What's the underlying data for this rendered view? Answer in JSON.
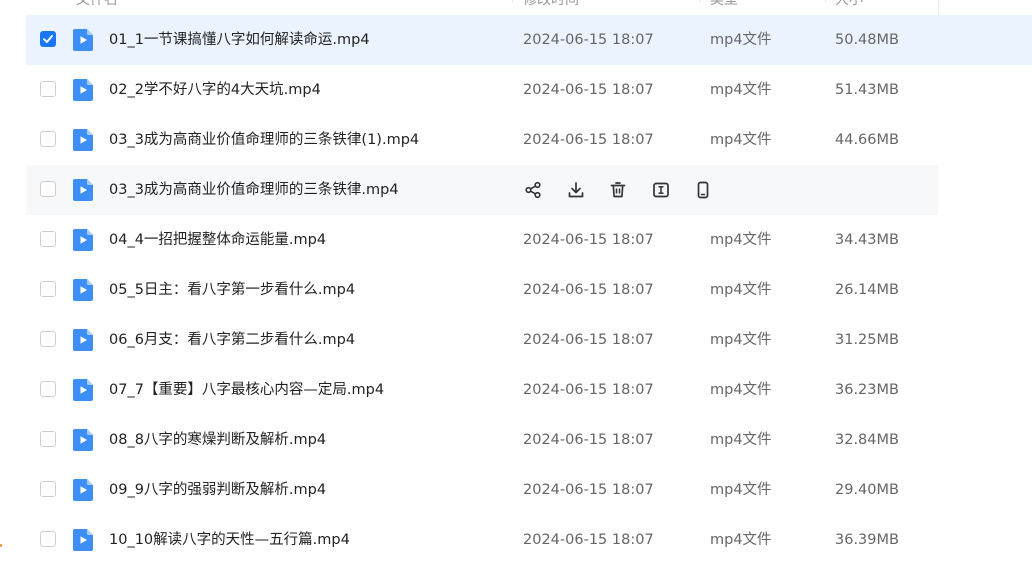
{
  "header": {
    "name_col": "文件名",
    "date_col": "修改时间",
    "type_col": "类型",
    "size_col": "大小"
  },
  "rows": [
    {
      "name": "01_1一节课搞懂八字如何解读命运.mp4",
      "date": "2024-06-15 18:07",
      "type": "mp4文件",
      "size": "50.48MB",
      "checked": true,
      "hover": false
    },
    {
      "name": "02_2学不好八字的4大天坑.mp4",
      "date": "2024-06-15 18:07",
      "type": "mp4文件",
      "size": "51.43MB",
      "checked": false,
      "hover": false
    },
    {
      "name": "03_3成为高商业价值命理师的三条铁律(1).mp4",
      "date": "2024-06-15 18:07",
      "type": "mp4文件",
      "size": "44.66MB",
      "checked": false,
      "hover": false
    },
    {
      "name": "03_3成为高商业价值命理师的三条铁律.mp4",
      "date": "",
      "type": "",
      "size": "",
      "checked": false,
      "hover": true
    },
    {
      "name": "04_4一招把握整体命运能量.mp4",
      "date": "2024-06-15 18:07",
      "type": "mp4文件",
      "size": "34.43MB",
      "checked": false,
      "hover": false
    },
    {
      "name": "05_5日主：看八字第一步看什么.mp4",
      "date": "2024-06-15 18:07",
      "type": "mp4文件",
      "size": "26.14MB",
      "checked": false,
      "hover": false
    },
    {
      "name": "06_6月支：看八字第二步看什么.mp4",
      "date": "2024-06-15 18:07",
      "type": "mp4文件",
      "size": "31.25MB",
      "checked": false,
      "hover": false
    },
    {
      "name": "07_7【重要】八字最核心内容—定局.mp4",
      "date": "2024-06-15 18:07",
      "type": "mp4文件",
      "size": "36.23MB",
      "checked": false,
      "hover": false
    },
    {
      "name": "08_8八字的寒燥判断及解析.mp4",
      "date": "2024-06-15 18:07",
      "type": "mp4文件",
      "size": "32.84MB",
      "checked": false,
      "hover": false
    },
    {
      "name": "09_9八字的强弱判断及解析.mp4",
      "date": "2024-06-15 18:07",
      "type": "mp4文件",
      "size": "29.40MB",
      "checked": false,
      "hover": false
    },
    {
      "name": "10_10解读八字的天性—五行篇.mp4",
      "date": "2024-06-15 18:07",
      "type": "mp4文件",
      "size": "36.39MB",
      "checked": false,
      "hover": false
    }
  ],
  "hover_actions": [
    "share-icon",
    "download-icon",
    "delete-icon",
    "rename-icon",
    "phone-icon"
  ],
  "colors": {
    "accent": "#1976f7",
    "selected_bg": "#ebf4fe",
    "hover_bg": "#f7f8fa",
    "file_icon": "#3e8ef7"
  }
}
